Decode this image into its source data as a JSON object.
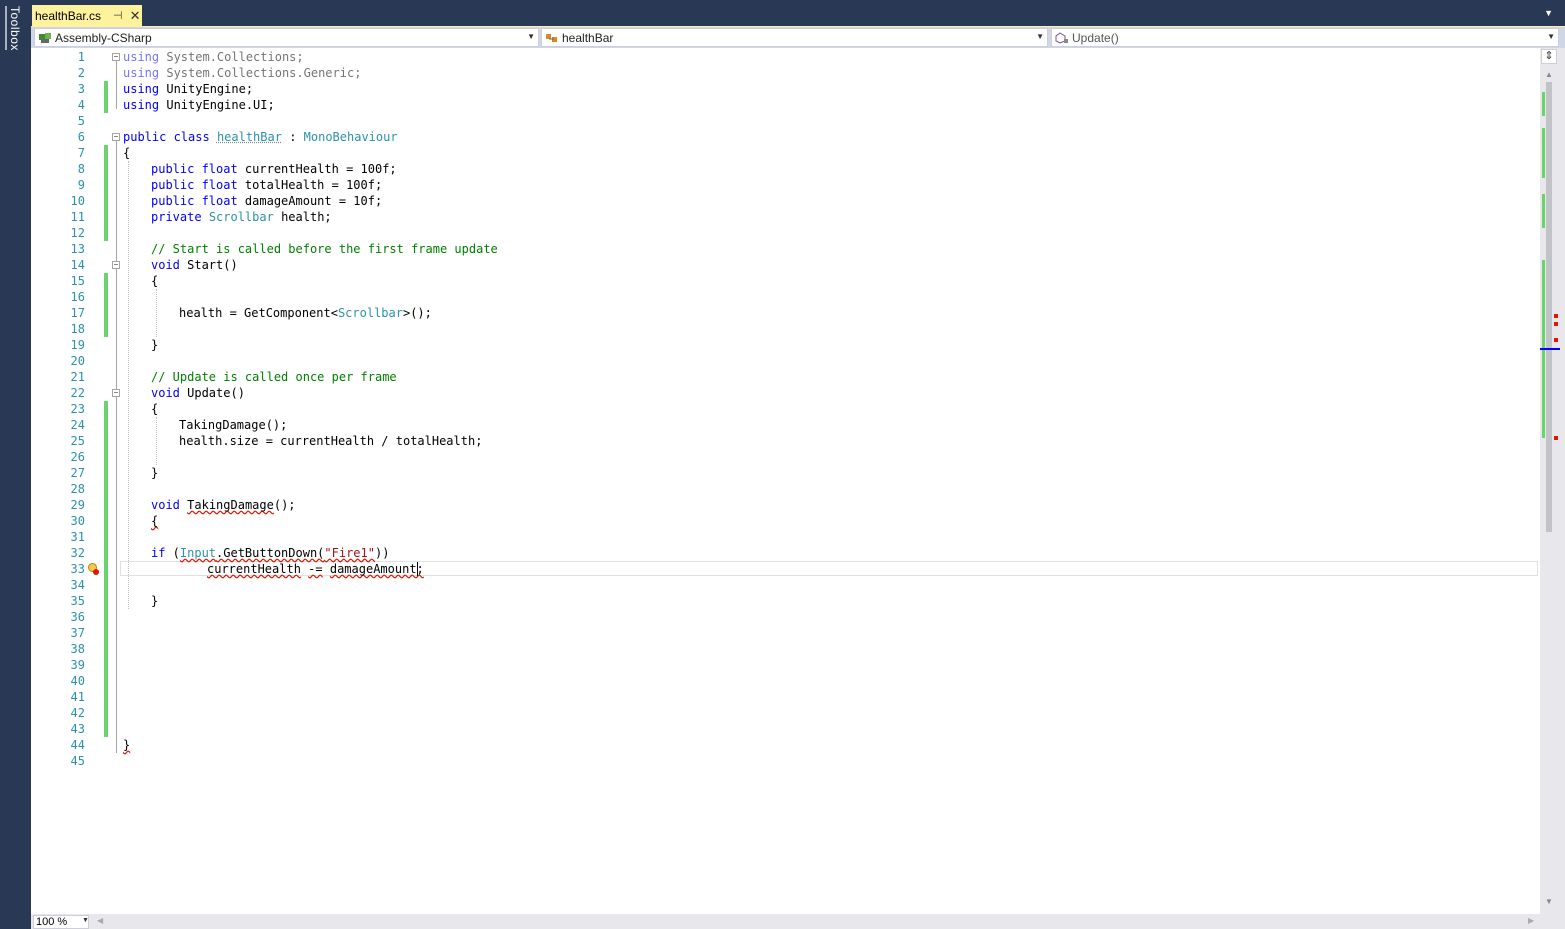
{
  "sidebar": {
    "toolbox_label": "Toolbox"
  },
  "tab": {
    "label": "healthBar.cs",
    "pin_glyph": "⊣",
    "close_glyph": "✕"
  },
  "navbar": {
    "project": "Assembly-CSharp",
    "class": "healthBar",
    "member": "Update()"
  },
  "editor": {
    "line_numbers": [
      "1",
      "2",
      "3",
      "4",
      "5",
      "6",
      "7",
      "8",
      "9",
      "10",
      "11",
      "12",
      "13",
      "14",
      "15",
      "16",
      "17",
      "18",
      "19",
      "20",
      "21",
      "22",
      "23",
      "24",
      "25",
      "26",
      "27",
      "28",
      "29",
      "30",
      "31",
      "32",
      "33",
      "34",
      "35",
      "36",
      "37",
      "38",
      "39",
      "40",
      "41",
      "42",
      "43",
      "44",
      "45"
    ],
    "lines": {
      "l1_kw": "using",
      "l1_rest": " System.Collections;",
      "l2_kw": "using",
      "l2_rest": " System.Collections.Generic;",
      "l3_kw": "using",
      "l3_rest": " UnityEngine;",
      "l4_kw": "using",
      "l4_rest": " UnityEngine.UI;",
      "l6_kw": "public class",
      "l6_sp": " ",
      "l6_name": "healthBar",
      "l6_colon": " : ",
      "l6_base": "MonoBehaviour",
      "l7": "{",
      "l8_kw": "public float",
      "l8_rest": " currentHealth = 100f;",
      "l9_kw": "public float",
      "l9_rest": " totalHealth = 100f;",
      "l10_kw": "public float",
      "l10_rest": " damageAmount = 10f;",
      "l11_kw": "private",
      "l11_sp": " ",
      "l11_ty": "Scrollbar",
      "l11_rest": " health;",
      "l13": "// Start is called before the first frame update",
      "l14_kw": "void",
      "l14_rest": " Start()",
      "l15": "{",
      "l17_a": "health = GetComponent<",
      "l17_ty": "Scrollbar",
      "l17_b": ">();",
      "l19": "}",
      "l21": "// Update is called once per frame",
      "l22_kw": "void",
      "l22_rest": " Update()",
      "l23": "{",
      "l24": "TakingDamage();",
      "l25": "health.size = currentHealth / totalHealth;",
      "l27": "}",
      "l29_kw": "void",
      "l29_sp": " ",
      "l29_name": "TakingDamage",
      "l29_rest": "();",
      "l30": "{",
      "l32_kw": "if",
      "l32_a": " (",
      "l32_ty": "Input",
      "l32_b": ".GetButtonDown(",
      "l32_st": "\"Fire1\"",
      "l32_c": "))",
      "l33_a": "currentHealth",
      "l33_sp": " ",
      "l33_op": "-=",
      "l33_sp2": " ",
      "l33_b": "damageAmount;",
      "l35": "}",
      "l44": "}"
    }
  },
  "statusbar": {
    "zoom": "100 %"
  },
  "colors": {
    "keyword": "#0000ff",
    "type": "#2b91af",
    "comment": "#008000",
    "string": "#a31515",
    "line_number": "#2b91af",
    "change_marker": "#6ad46a",
    "error_squiggle": "#e51400",
    "tab_active": "#fff29d",
    "chrome_dark": "#293955"
  },
  "icons": [
    "close-icon",
    "pin-icon",
    "project-icon",
    "class-icon",
    "method-icon",
    "chevron-down-icon",
    "lightbulb-icon",
    "split-icon"
  ]
}
